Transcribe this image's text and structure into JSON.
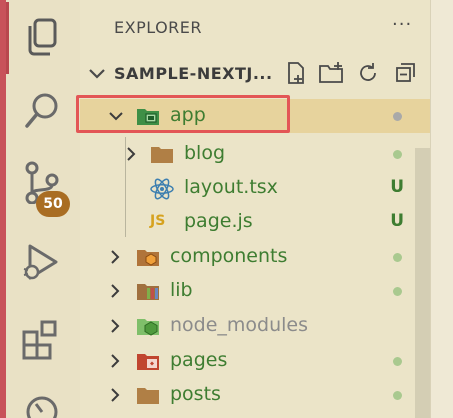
{
  "activity_bar": {
    "items": [
      {
        "name": "explorer-icon"
      },
      {
        "name": "search-icon"
      },
      {
        "name": "source-control-icon",
        "badge": "50"
      },
      {
        "name": "run-debug-icon"
      },
      {
        "name": "extensions-icon"
      },
      {
        "name": "timeline-icon"
      }
    ]
  },
  "sidebar": {
    "title": "EXPLORER",
    "more_actions": "···",
    "section": {
      "title": "SAMPLE-NEXTJ...",
      "actions": [
        "new-file-icon",
        "new-folder-icon",
        "refresh-icon",
        "collapse-all-icon"
      ]
    },
    "tree": [
      {
        "label": "app",
        "type": "folder",
        "expanded": true,
        "status": "dot-grey",
        "color": "green"
      },
      {
        "label": "blog",
        "type": "folder",
        "expanded": false,
        "status": "dot-green",
        "color": "green"
      },
      {
        "label": "layout.tsx",
        "type": "react-file",
        "status": "U",
        "color": "green"
      },
      {
        "label": "page.js",
        "type": "js-file",
        "icon_text": "JS",
        "status": "U",
        "color": "green"
      },
      {
        "label": "components",
        "type": "folder",
        "expanded": false,
        "status": "dot-green",
        "color": "green"
      },
      {
        "label": "lib",
        "type": "folder",
        "expanded": false,
        "status": "dot-green",
        "color": "green"
      },
      {
        "label": "node_modules",
        "type": "folder",
        "expanded": false,
        "status": "none",
        "color": "grey"
      },
      {
        "label": "pages",
        "type": "folder",
        "expanded": false,
        "status": "dot-green",
        "color": "green"
      },
      {
        "label": "posts",
        "type": "folder",
        "expanded": false,
        "status": "dot-green",
        "color": "green"
      }
    ]
  },
  "colors": {
    "accent_red": "#e35656",
    "selected_bg": "#e7d39d",
    "git_green": "#3e7d31",
    "badge_bg": "#a96d23"
  }
}
